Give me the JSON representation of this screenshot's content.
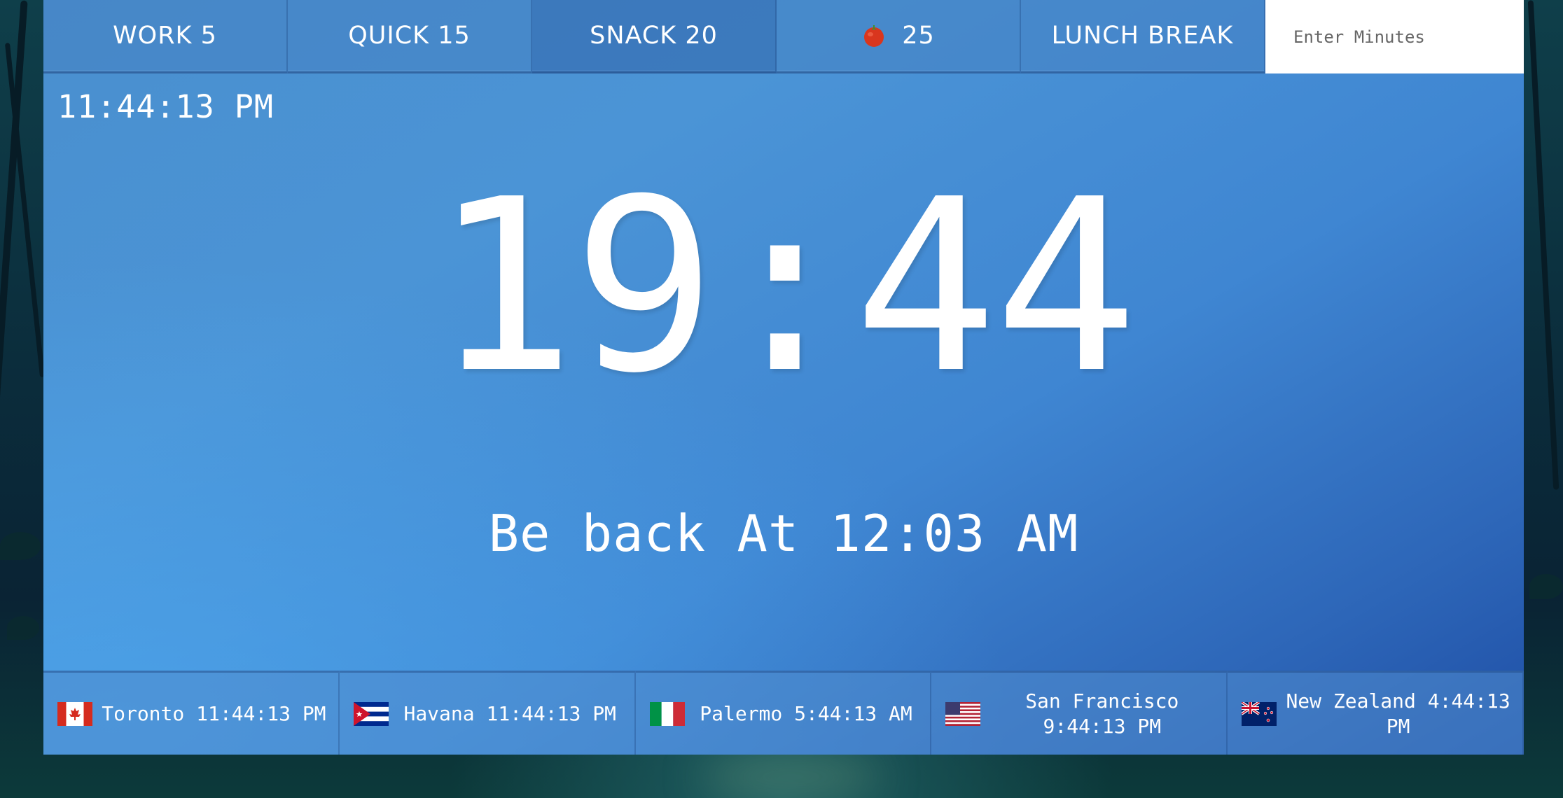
{
  "presets": [
    {
      "label": "WORK 5"
    },
    {
      "label": "QUICK 15"
    },
    {
      "label": "SNACK 20"
    },
    {
      "label": "25",
      "icon": "tomato-icon"
    },
    {
      "label": "LUNCH BREAK"
    }
  ],
  "minutes_input": {
    "placeholder": "Enter Minutes",
    "value": ""
  },
  "local_time": "11:44:13 PM",
  "countdown": "19:44",
  "back_at": "Be back At 12:03 AM",
  "zones": [
    {
      "flag": "canada-flag-icon",
      "label": "Toronto 11:44:13 PM"
    },
    {
      "flag": "cuba-flag-icon",
      "label": "Havana 11:44:13 PM"
    },
    {
      "flag": "italy-flag-icon",
      "label": "Palermo 5:44:13 AM"
    },
    {
      "flag": "usa-flag-icon",
      "label": "San Francisco 9:44:13 PM"
    },
    {
      "flag": "new-zealand-flag-icon",
      "label": "New Zealand 4:44:13 PM"
    }
  ],
  "colors": {
    "panel_accent": "#4a8fce",
    "text": "#ffffff",
    "input_bg": "#ffffff"
  }
}
